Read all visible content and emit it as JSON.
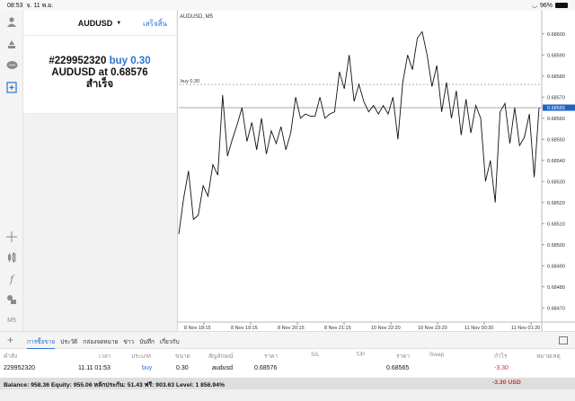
{
  "status": {
    "time": "08:53",
    "date": "จ. 11 พ.ย.",
    "battery": "96%",
    "battery_level": 0.96
  },
  "sidebar_left": {
    "timeframe": "M5"
  },
  "order_panel": {
    "symbol": "AUDUSD",
    "done_label": "เสร็จสิ้น",
    "order_id": "#229952320",
    "action": "buy 0.30",
    "symbol_at": "AUDUSD at",
    "price": "0.68576",
    "status": "สำเร็จ"
  },
  "chart": {
    "title": "AUDUSD, M5",
    "buy_line_label": "buy 0.30",
    "current_price": "0.68565",
    "price_labels": [
      "0.68600",
      "0.68590",
      "0.68580",
      "0.68570",
      "0.68560",
      "0.68550",
      "0.68540",
      "0.68530",
      "0.68520",
      "0.68510",
      "0.68500",
      "0.68490",
      "0.68480",
      "0.68470"
    ],
    "time_labels": [
      "8 Nov 18:15",
      "8 Nov 19:15",
      "8 Nov 20:15",
      "8 Nov 21:15",
      "10 Nov 22:20",
      "10 Nov 23:20",
      "11 Nov 00:20",
      "11 Nov 01:20"
    ]
  },
  "chart_data": {
    "type": "line",
    "title": "AUDUSD, M5",
    "ylim": [
      0.68465,
      0.68605
    ],
    "buy_level": 0.68576,
    "current_price": 0.68565,
    "x": [
      "8 Nov 18:15",
      "8 Nov 19:15",
      "8 Nov 20:15",
      "8 Nov 21:15",
      "10 Nov 22:20",
      "10 Nov 23:20",
      "11 Nov 00:20",
      "11 Nov 01:20"
    ],
    "y": [
      0.68505,
      0.68522,
      0.68535,
      0.68512,
      0.68514,
      0.68528,
      0.68523,
      0.68538,
      0.68533,
      0.68571,
      0.68542,
      0.6855,
      0.68557,
      0.68565,
      0.68549,
      0.68558,
      0.68545,
      0.6856,
      0.68543,
      0.68554,
      0.68548,
      0.68556,
      0.68545,
      0.68553,
      0.6857,
      0.6856,
      0.68562,
      0.68561,
      0.68561,
      0.6857,
      0.6856,
      0.68562,
      0.68563,
      0.68582,
      0.68574,
      0.6859,
      0.68568,
      0.68576,
      0.68568,
      0.68563,
      0.68566,
      0.68562,
      0.68566,
      0.68562,
      0.6857,
      0.6855,
      0.68577,
      0.6859,
      0.68583,
      0.68598,
      0.68601,
      0.6859,
      0.68575,
      0.68585,
      0.68563,
      0.68577,
      0.6856,
      0.68573,
      0.68552,
      0.68569,
      0.68553,
      0.68566,
      0.6856,
      0.6853,
      0.6854,
      0.6852,
      0.68563,
      0.68567,
      0.68548,
      0.68565,
      0.68547,
      0.68551,
      0.68562,
      0.68532,
      0.68565
    ]
  },
  "tabs": [
    "การซื้อขาย",
    "ประวัติ",
    "กล่องจดหมาย",
    "ข่าว",
    "บันทึก",
    "เกี่ยวกับ"
  ],
  "table": {
    "headers": [
      "คำสั่ง",
      "เวลา",
      "ประเภท",
      "ขนาด",
      "สัญลักษณ์",
      "ราคา",
      "S/L",
      "T/P",
      "ราคา",
      "Swap",
      "กำไร",
      "หมายเหตุ"
    ],
    "row": {
      "order": "229952320",
      "time": "11.11 01:53",
      "type": "buy",
      "size": "0.30",
      "symbol": "audusd",
      "open_price": "0.68576",
      "current_price": "0.68565",
      "profit": "-3.30"
    }
  },
  "balance": {
    "text": "Balance: 958.36 Equity: 955.06 หลักประกัน: 51.43 ฟรี: 903.63 Level: 1 856.94%",
    "total": "-3.30 USD"
  },
  "colors": {
    "accent": "#2b73d1",
    "loss": "#d23030",
    "current_price_bg": "#1f63c6"
  }
}
